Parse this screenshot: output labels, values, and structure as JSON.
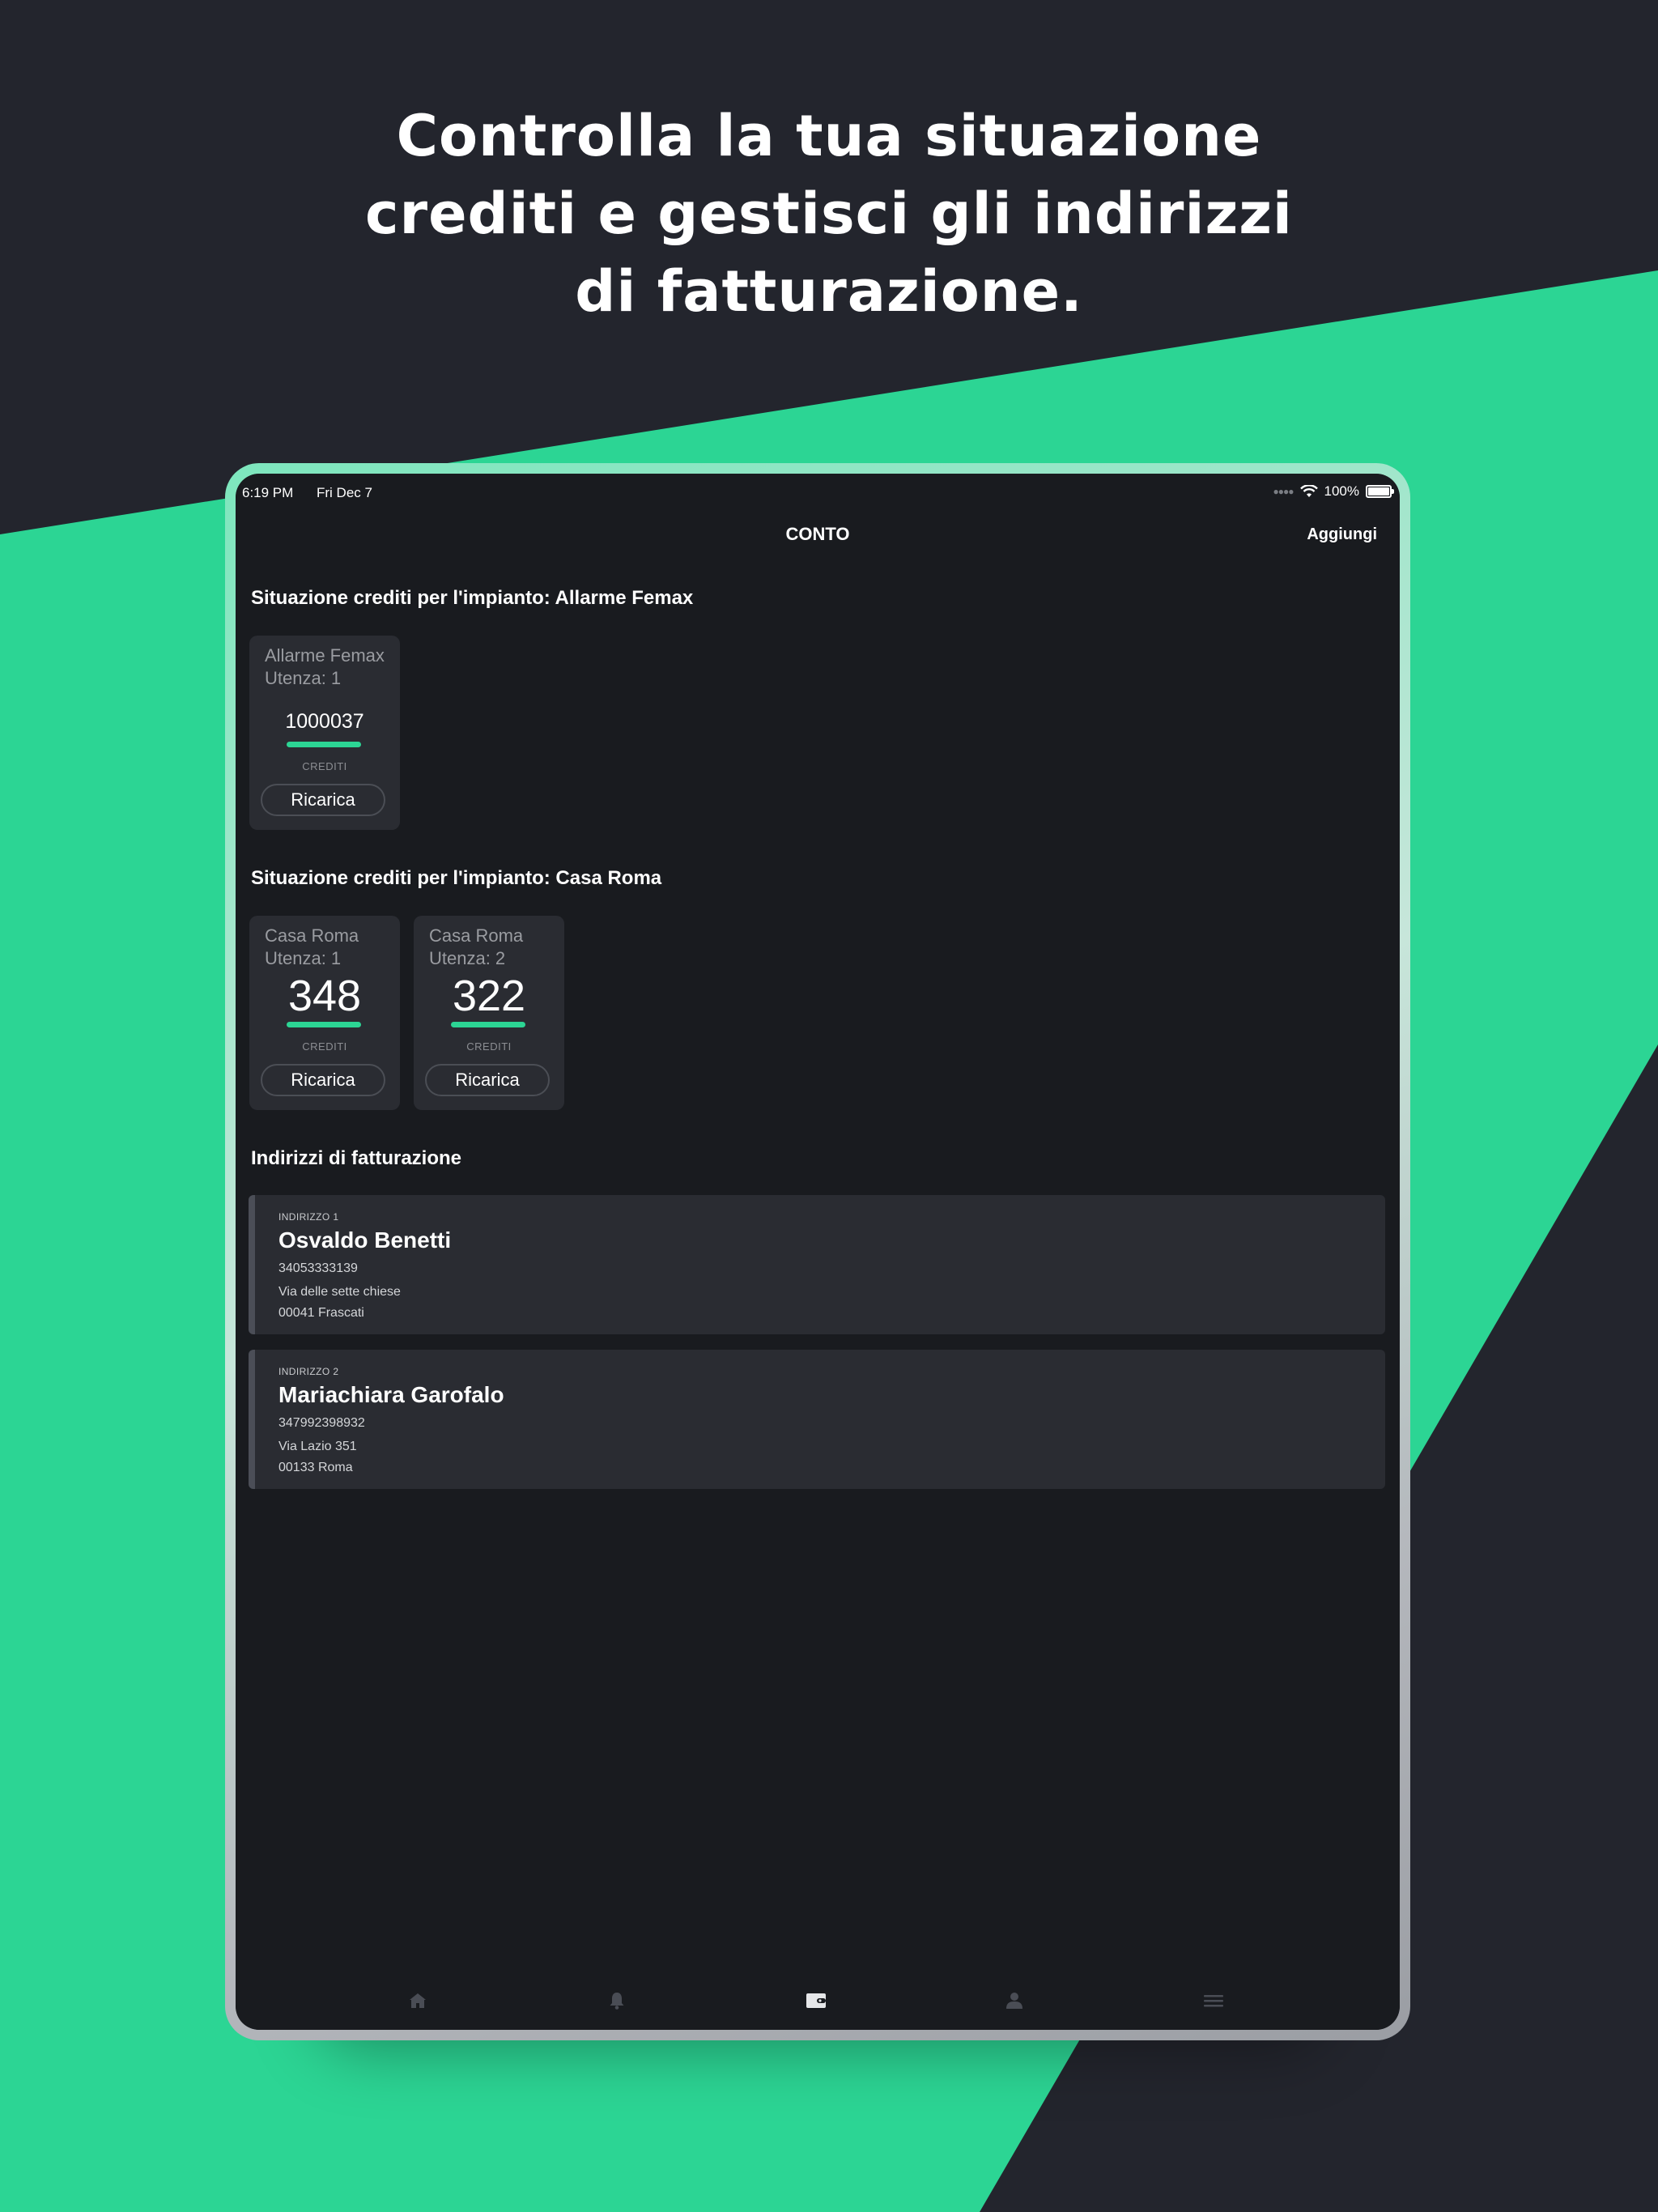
{
  "headline": {
    "line1": "Controlla la tua situazione",
    "line2": "crediti e gestisci gli indirizzi",
    "line3": "di fatturazione."
  },
  "colors": {
    "background_dark": "#23252d",
    "accent_green": "#2cd594",
    "screen_bg": "#191b1f",
    "card_bg": "#2a2c32"
  },
  "status_bar": {
    "time": "6:19 PM",
    "date": "Fri Dec 7",
    "battery": "100%"
  },
  "nav": {
    "title": "CONTO",
    "action": "Aggiungi"
  },
  "sections": [
    {
      "title": "Situazione crediti per l'impianto: Allarme Femax",
      "cards": [
        {
          "name": "Allarme Femax",
          "user": "Utenza: 1",
          "value": "1000037",
          "label": "CREDITI",
          "button": "Ricarica"
        }
      ]
    },
    {
      "title": "Situazione crediti per l'impianto: Casa Roma",
      "cards": [
        {
          "name": "Casa Roma",
          "user": "Utenza: 1",
          "value": "348",
          "label": "CREDITI",
          "button": "Ricarica"
        },
        {
          "name": "Casa Roma",
          "user": "Utenza: 2",
          "value": "322",
          "label": "CREDITI",
          "button": "Ricarica"
        }
      ]
    }
  ],
  "billing": {
    "title": "Indirizzi di fatturazione",
    "addresses": [
      {
        "index": "INDIRIZZO 1",
        "name": "Osvaldo Benetti",
        "phone": "34053333139",
        "street": "Via delle sette chiese",
        "city": "00041 Frascati"
      },
      {
        "index": "INDIRIZZO 2",
        "name": "Mariachiara Garofalo",
        "phone": "347992398932",
        "street": "Via Lazio 351",
        "city": "00133 Roma"
      }
    ]
  },
  "tabbar": {
    "items": [
      {
        "icon": "home-icon",
        "active": false
      },
      {
        "icon": "bell-icon",
        "active": false
      },
      {
        "icon": "wallet-icon",
        "active": true
      },
      {
        "icon": "user-icon",
        "active": false
      },
      {
        "icon": "menu-icon",
        "active": false
      }
    ]
  }
}
